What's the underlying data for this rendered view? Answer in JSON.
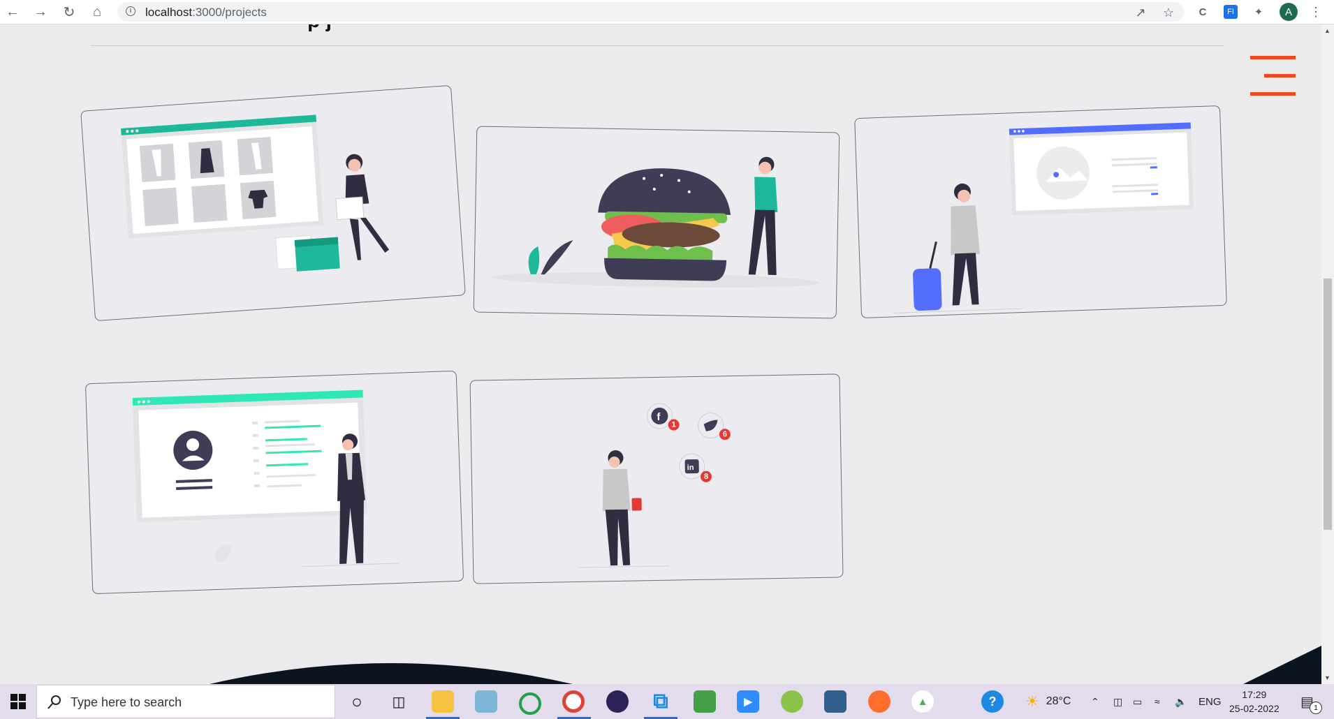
{
  "browser": {
    "url_host": "localhost",
    "url_path": ":3000/projects"
  },
  "page": {
    "heading_fragment": "p  j",
    "menu_color": "#f0491d",
    "cards": [
      {
        "illustration": "online-clothing-store"
      },
      {
        "illustration": "burger-with-person"
      },
      {
        "illustration": "traveler-with-suitcase"
      },
      {
        "illustration": "profile-presentation"
      },
      {
        "illustration": "social-notifications"
      }
    ],
    "social_badges": {
      "facebook": "1",
      "twitter": "6",
      "linkedin": "8"
    }
  },
  "taskbar": {
    "search_placeholder": "Type here to search",
    "weather": "28°C",
    "language": "ENG",
    "time": "17:29",
    "date": "25-02-2022",
    "notification_count": "1"
  }
}
